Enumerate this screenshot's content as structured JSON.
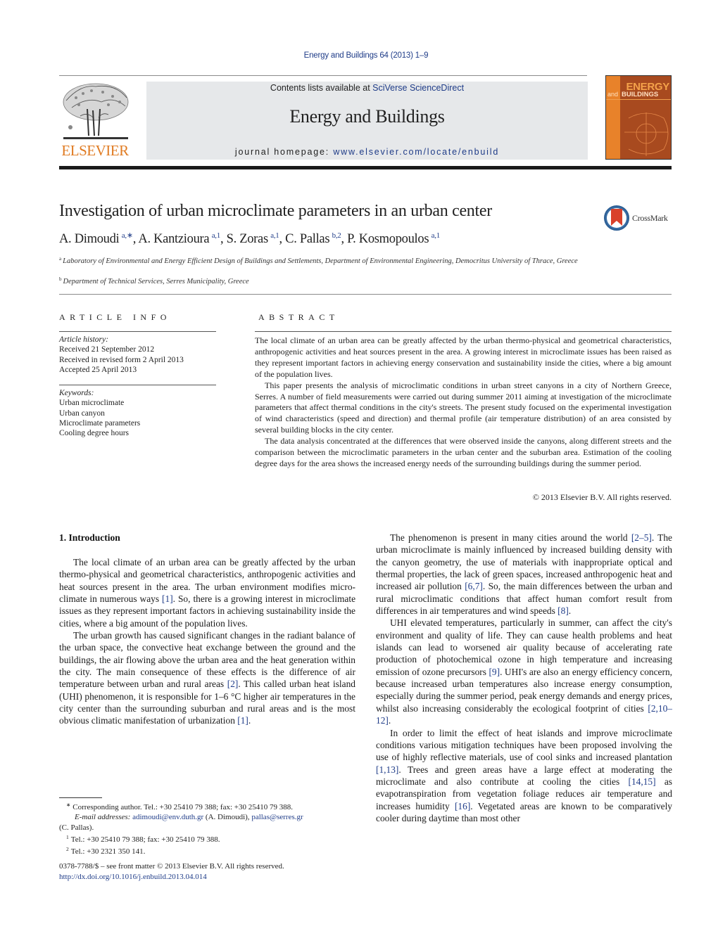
{
  "header": {
    "journal_ref": "Energy and Buildings 64 (2013) 1–9",
    "contents_prefix": "Contents lists available at ",
    "contents_link": "SciVerse ScienceDirect",
    "journal_title": "Energy and Buildings",
    "homepage_prefix": "journal homepage: ",
    "homepage_link": "www.elsevier.com/locate/enbuild",
    "publisher_logo_text": "ELSEVIER",
    "cover": {
      "title_line1": "ENERGY",
      "title_and": "and",
      "title_line2": "BUILDINGS"
    },
    "colors": {
      "link": "#1f3c88",
      "elsevier_orange": "#e07b22",
      "banner_bg": "#e6e8ea",
      "cover_bg": "#a84a1f"
    }
  },
  "article": {
    "title": "Investigation of urban microclimate parameters in an urban center",
    "crossmark_label": "CrossMark",
    "authors": [
      {
        "name": "A. Dimoudi",
        "sup": "a,∗"
      },
      {
        "name": "A. Kantzioura",
        "sup": "a,1"
      },
      {
        "name": "S. Zoras",
        "sup": "a,1"
      },
      {
        "name": "C. Pallas",
        "sup": "b,2"
      },
      {
        "name": "P. Kosmopoulos",
        "sup": "a,1"
      }
    ],
    "affiliations": [
      {
        "mark": "a",
        "text": "Laboratory of Environmental and Energy Efficient Design of Buildings and Settlements, Department of Environmental Engineering, Democritus University of Thrace, Greece"
      },
      {
        "mark": "b",
        "text": "Department of Technical Services, Serres Municipality, Greece"
      }
    ]
  },
  "article_info": {
    "heading": "ARTICLE INFO",
    "history_label": "Article history:",
    "history": [
      "Received 21 September 2012",
      "Received in revised form 2 April 2013",
      "Accepted 25 April 2013"
    ],
    "keywords_label": "Keywords:",
    "keywords": [
      "Urban microclimate",
      "Urban canyon",
      "Microclimate parameters",
      "Cooling degree hours"
    ]
  },
  "abstract": {
    "heading": "ABSTRACT",
    "paragraphs": [
      "The local climate of an urban area can be greatly affected by the urban thermo-physical and geometrical characteristics, anthropogenic activities and heat sources present in the area. A growing interest in microclimate issues has been raised as they represent important factors in achieving energy conservation and sustainability inside the cities, where a big amount of the population lives.",
      "This paper presents the analysis of microclimatic conditions in urban street canyons in a city of Northern Greece, Serres. A number of field measurements were carried out during summer 2011 aiming at investigation of the microclimate parameters that affect thermal conditions in the city's streets. The present study focused on the experimental investigation of wind characteristics (speed and direction) and thermal profile (air temperature distribution) of an area consisted by several building blocks in the city center.",
      "The data analysis concentrated at the differences that were observed inside the canyons, along different streets and the comparison between the microclimatic parameters in the urban center and the suburban area. Estimation of the cooling degree days for the area shows the increased energy needs of the surrounding buildings during the summer period."
    ],
    "copyright": "© 2013 Elsevier B.V. All rights reserved."
  },
  "body": {
    "section_heading": "1.  Introduction",
    "left_column": [
      [
        {
          "t": "The local climate of an urban area can be greatly affected by the urban thermo-physical and geometrical characteristics, anthropogenic activities and heat sources present in the area. The urban environment modifies micro-climate in numerous ways "
        },
        {
          "c": "[1]"
        },
        {
          "t": ". So, there is a growing interest in microclimate issues as they represent important factors in achieving sustainability inside the cities, where a big amount of the population lives."
        }
      ],
      [
        {
          "t": "The urban growth has caused significant changes in the radiant balance of the urban space, the convective heat exchange between the ground and the buildings, the air flowing above the urban area and the heat generation within the city. The main consequence of these effects is the difference of air temperature between urban and rural areas "
        },
        {
          "c": "[2]"
        },
        {
          "t": ". This called urban heat island (UHI) phenomenon, it is responsible for 1–6 °C higher air temperatures in the city center than the surrounding suburban and rural areas and is the most obvious climatic manifestation of urbanization "
        },
        {
          "c": "[1]"
        },
        {
          "t": "."
        }
      ]
    ],
    "right_column": [
      [
        {
          "t": "The phenomenon is present in many cities around the world "
        },
        {
          "c": "[2–5]"
        },
        {
          "t": ". The urban microclimate is mainly influenced by increased building density with the canyon geometry, the use of materials with inappropriate optical and thermal properties, the lack of green spaces, increased anthropogenic heat and increased air pollution "
        },
        {
          "c": "[6,7]"
        },
        {
          "t": ". So, the main differences between the urban and rural microclimatic conditions that affect human comfort result from differences in air temperatures and wind speeds "
        },
        {
          "c": "[8]"
        },
        {
          "t": "."
        }
      ],
      [
        {
          "t": "UHI elevated temperatures, particularly in summer, can affect the city's environment and quality of life. They can cause health problems and heat islands can lead to worsened air quality because of accelerating rate production of photochemical ozone in high temperature and increasing emission of ozone precursors "
        },
        {
          "c": "[9]"
        },
        {
          "t": ". UHI's are also an energy efficiency concern, because increased urban temperatures also increase energy consumption, especially during the summer period, peak energy demands and energy prices, whilst also increasing considerably the ecological footprint of cities "
        },
        {
          "c": "[2,10–12]"
        },
        {
          "t": "."
        }
      ],
      [
        {
          "t": "In order to limit the effect of heat islands and improve microclimate conditions various mitigation techniques have been proposed involving the use of highly reflective materials, use of cool sinks and increased plantation "
        },
        {
          "c": "[1,13]"
        },
        {
          "t": ". Trees and green areas have a large effect at moderating the microclimate and also contribute at cooling the cities "
        },
        {
          "c": "[14,15]"
        },
        {
          "t": " as evapotranspiration from vegetation foliage reduces air temperature and increases humidity "
        },
        {
          "c": "[16]"
        },
        {
          "t": ". Vegetated areas are known to be comparatively cooler during daytime than most other"
        }
      ]
    ]
  },
  "footnotes": {
    "corresponding_mark": "∗",
    "corresponding": "Corresponding author. Tel.: +30 25410 79 388; fax: +30 25410 79 388.",
    "email_label": "E-mail addresses:",
    "email1": "adimoudi@env.duth.gr",
    "email1_owner": " (A. Dimoudi), ",
    "email2": "pallas@serres.gr",
    "email2_owner": "(C. Pallas).",
    "note1_mark": "1",
    "note1": "Tel.: +30 25410 79 388; fax: +30 25410 79 388.",
    "note2_mark": "2",
    "note2": "Tel.: +30 2321 350 141.",
    "front_matter": "0378-7788/$ – see front matter © 2013 Elsevier B.V. All rights reserved.",
    "doi": "http://dx.doi.org/10.1016/j.enbuild.2013.04.014"
  }
}
